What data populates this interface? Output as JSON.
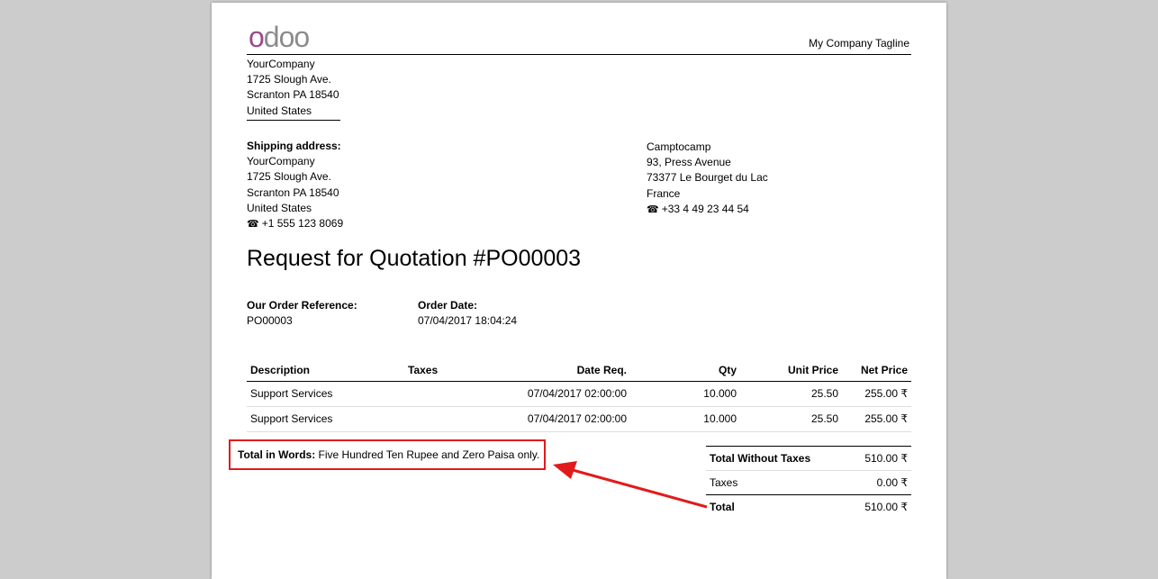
{
  "header": {
    "logo_first": "o",
    "logo_rest": "doo",
    "tagline": "My Company Tagline"
  },
  "company": {
    "name": "YourCompany",
    "street": "1725 Slough Ave.",
    "city": "Scranton PA 18540",
    "country": "United States"
  },
  "shipping": {
    "label": "Shipping address:",
    "name": "YourCompany",
    "street": "1725 Slough Ave.",
    "city": "Scranton PA 18540",
    "country": "United States",
    "phone": "+1 555 123 8069"
  },
  "vendor": {
    "name": "Camptocamp",
    "street": "93, Press Avenue",
    "city": "73377 Le Bourget du Lac",
    "country": "France",
    "phone": "+33 4 49 23 44 54"
  },
  "doc": {
    "title": "Request for Quotation #PO00003",
    "ref_label": "Our Order Reference:",
    "ref_value": "PO00003",
    "date_label": "Order Date:",
    "date_value": "07/04/2017 18:04:24"
  },
  "lines": {
    "headers": {
      "description": "Description",
      "taxes": "Taxes",
      "date_req": "Date Req.",
      "qty": "Qty",
      "unit_price": "Unit Price",
      "net_price": "Net Price"
    },
    "rows": [
      {
        "description": "Support Services",
        "taxes": "",
        "date_req": "07/04/2017 02:00:00",
        "qty": "10.000",
        "unit_price": "25.50",
        "net_price": "255.00 ₹"
      },
      {
        "description": "Support Services",
        "taxes": "",
        "date_req": "07/04/2017 02:00:00",
        "qty": "10.000",
        "unit_price": "25.50",
        "net_price": "255.00 ₹"
      }
    ]
  },
  "words": {
    "label": "Total in Words:",
    "value": " Five Hundred Ten Rupee and Zero Paisa only."
  },
  "totals": {
    "without_taxes_label": "Total Without Taxes",
    "without_taxes_value": "510.00 ₹",
    "taxes_label": "Taxes",
    "taxes_value": "0.00 ₹",
    "total_label": "Total",
    "total_value": "510.00 ₹"
  },
  "colors": {
    "logo_accent": "#9b4a8c",
    "logo_gray": "#8c8c8c",
    "annotation_red": "#e11b1b",
    "background": "#cccccc"
  }
}
